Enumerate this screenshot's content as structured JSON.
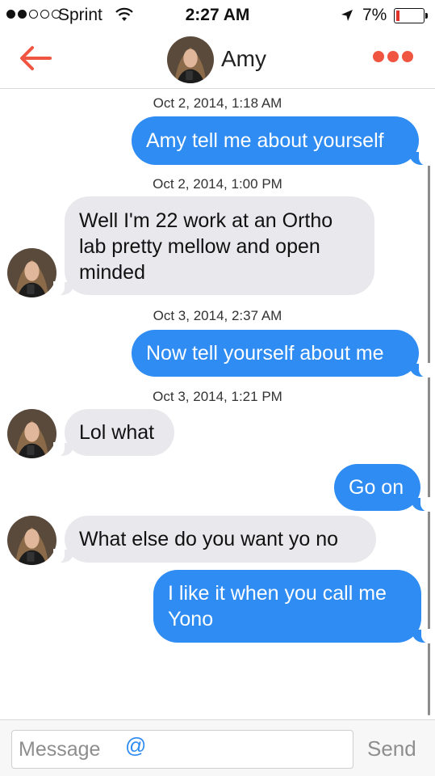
{
  "status_bar": {
    "carrier": "Sprint",
    "time": "2:27 AM",
    "battery": "7%",
    "battery_level": 0.07,
    "signal_bars": 2
  },
  "header": {
    "contact_name": "Amy",
    "back_icon": "arrow-left-icon",
    "more_icon": "more-dots-icon",
    "accent_color": "#ef5540"
  },
  "messages": [
    {
      "timestamp": "Oct 2, 2014, 1:18 AM",
      "direction": "out",
      "text": "Amy tell me about yourself"
    },
    {
      "timestamp": "Oct 2, 2014, 1:00 PM",
      "direction": "in",
      "lines": [
        "Well I'm 22 work at an Ortho",
        "lab pretty mellow and open",
        "minded"
      ]
    },
    {
      "timestamp": "Oct 3, 2014, 2:37 AM",
      "direction": "out",
      "text": "Now tell yourself about me"
    },
    {
      "timestamp": "Oct 3, 2014, 1:21 PM",
      "direction": "in",
      "text": "Lol what"
    },
    {
      "direction": "out",
      "text": "Go on"
    },
    {
      "direction": "in",
      "text": "What else do you want yo no"
    },
    {
      "direction": "out",
      "lines": [
        "I like it when you call me",
        "Yono"
      ]
    }
  ],
  "composer": {
    "placeholder": "Message",
    "mention_icon": "@",
    "send_label": "Send"
  },
  "colors": {
    "outgoing_bubble": "#2f8cf2",
    "incoming_bubble": "#e9e9ed"
  }
}
